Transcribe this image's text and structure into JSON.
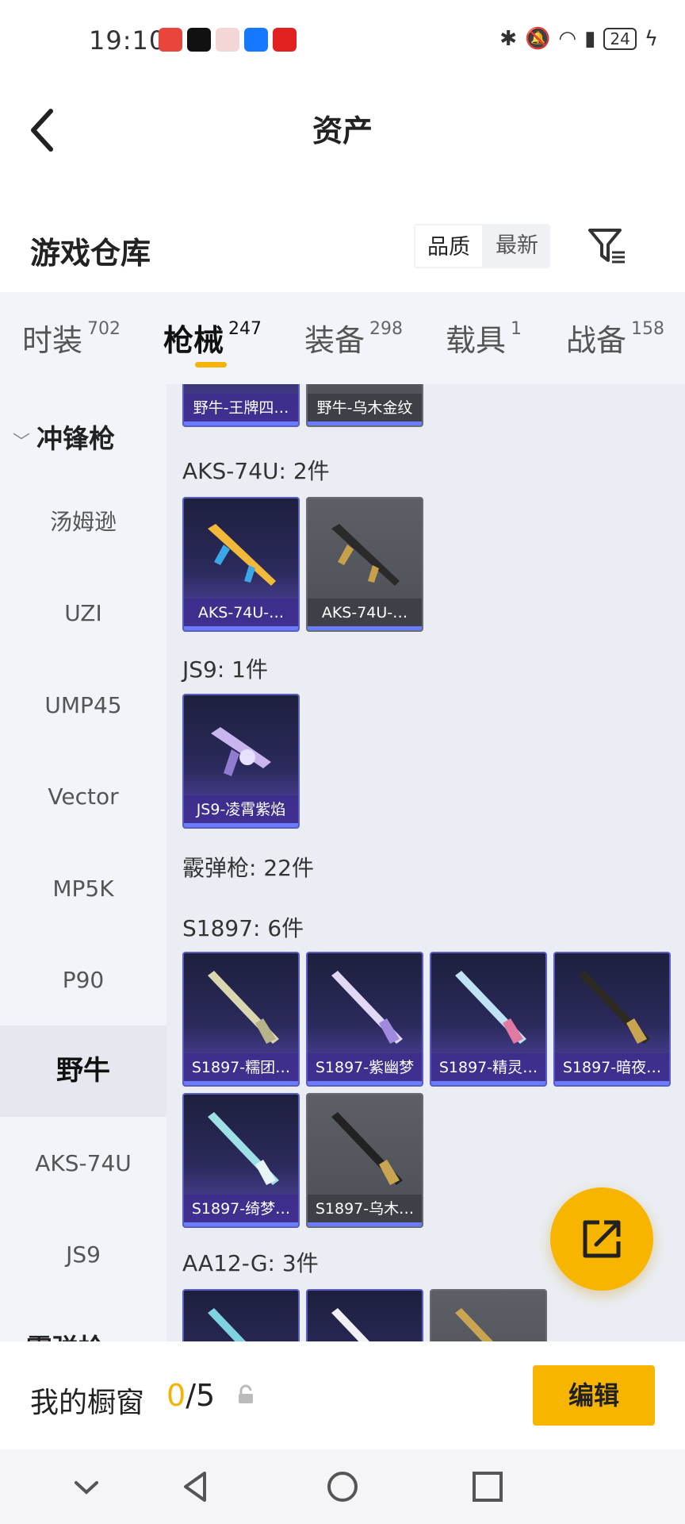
{
  "status": {
    "time": "19:10",
    "battery": "24"
  },
  "header": {
    "title": "资产"
  },
  "warehouse": {
    "title": "游戏仓库",
    "sort": [
      "品质",
      "最新"
    ]
  },
  "tabs": [
    {
      "label": "时装",
      "count": "702"
    },
    {
      "label": "枪械",
      "count": "247"
    },
    {
      "label": "装备",
      "count": "298"
    },
    {
      "label": "载具",
      "count": "1"
    },
    {
      "label": "战备",
      "count": "158"
    }
  ],
  "sidebar": {
    "group1": "冲锋枪",
    "items": [
      "汤姆逊",
      "UZI",
      "UMP45",
      "Vector",
      "MP5K",
      "P90",
      "野牛",
      "AKS-74U",
      "JS9"
    ],
    "group2": "霰弹枪"
  },
  "content": {
    "top_cards": [
      "野牛-王牌四…",
      "野牛-乌木金纹"
    ],
    "aks_title": "AKS-74U: 2件",
    "aks_cards": [
      "AKS-74U-…",
      "AKS-74U-…"
    ],
    "js9_title": "JS9: 1件",
    "js9_cards": [
      "JS9-凌霄紫焰"
    ],
    "shotgun_title": "霰弹枪: 22件",
    "s1897_title": "S1897: 6件",
    "s1897_cards": [
      "S1897-糯团…",
      "S1897-紫幽梦",
      "S1897-精灵…",
      "S1897-暗夜…",
      "S1897-绮梦…",
      "S1897-乌木…"
    ],
    "aa12_title": "AA12-G: 3件"
  },
  "bottom": {
    "showcase_label": "我的橱窗",
    "count_current": "0",
    "count_total": "/5",
    "edit_label": "编辑"
  },
  "colors": {
    "accent": "#f8b500",
    "card_purple": "#2b2a5c",
    "card_gray": "#55575e"
  }
}
